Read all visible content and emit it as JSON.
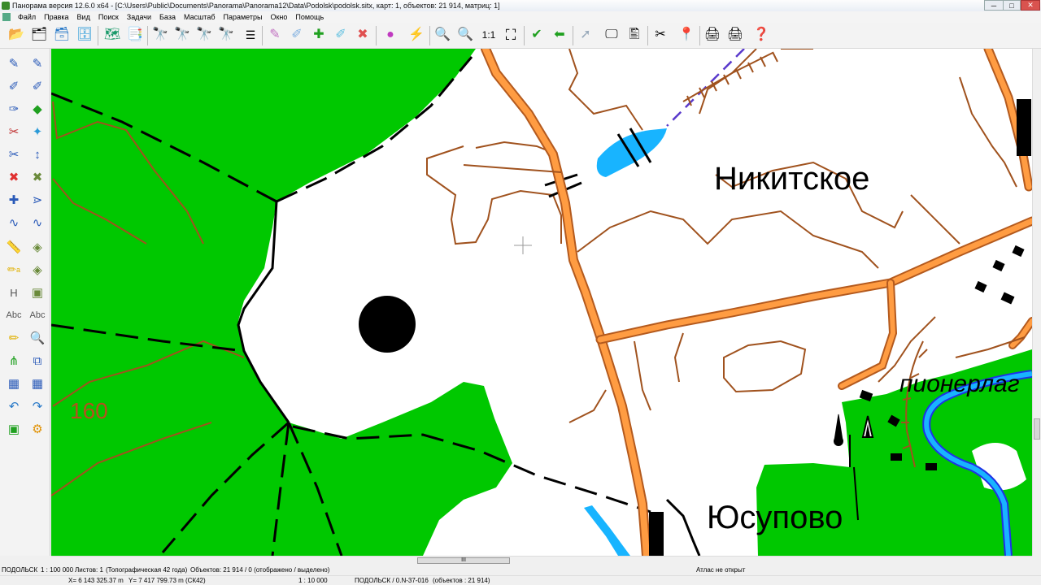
{
  "window": {
    "title": "Панорама версия 12.6.0 x64 - [C:\\Users\\Public\\Documents\\Panorama\\Panorama12\\Data\\Podolsk\\podolsk.sitx, карт: 1, объектов: 21 914, матриц: 1]",
    "minimize_label": "─",
    "maximize_label": "□",
    "close_label": "✕"
  },
  "menu": [
    "Файл",
    "Правка",
    "Вид",
    "Поиск",
    "Задачи",
    "База",
    "Масштаб",
    "Параметры",
    "Окно",
    "Помощь"
  ],
  "toolbar": {
    "scale_label": "1:1"
  },
  "left_tools": {
    "h_label": "H",
    "abc1_label": "Abc",
    "abc2_label": "Abc",
    "a_label": "a"
  },
  "map": {
    "labels": {
      "nikitskoe": "Никитское",
      "yusupovo": "Юсупово",
      "pioner": "пионерлаг",
      "height_160": "160"
    },
    "colors": {
      "forest": "#00c800",
      "road": "#ff9c42",
      "road_outline": "#b45a1e",
      "contour": "#a0521e",
      "water": "#18b4ff",
      "river_outline": "#1e32e6",
      "boundary": "#000000"
    }
  },
  "hscroll_thumb_label": "III",
  "status": {
    "map_name": "ПОДОЛЬСК",
    "scale": "1 : 100 000",
    "sheets": "Листов: 1",
    "type": "(Топографическая 42 года)",
    "objects": "Объектов: 21 914 / 0 (отображено / выделено)",
    "atlas": "Атлас не открыт",
    "x_coord": "X= 6 143 325.37 m",
    "y_coord": "Y= 7 417 799.73 m",
    "crs": "(СК42)",
    "current_scale": "1 : 10 000",
    "sheet_info": "ПОДОЛЬСК / 0.N-37-016",
    "sheet_objects": "(объектов : 21 914)"
  }
}
